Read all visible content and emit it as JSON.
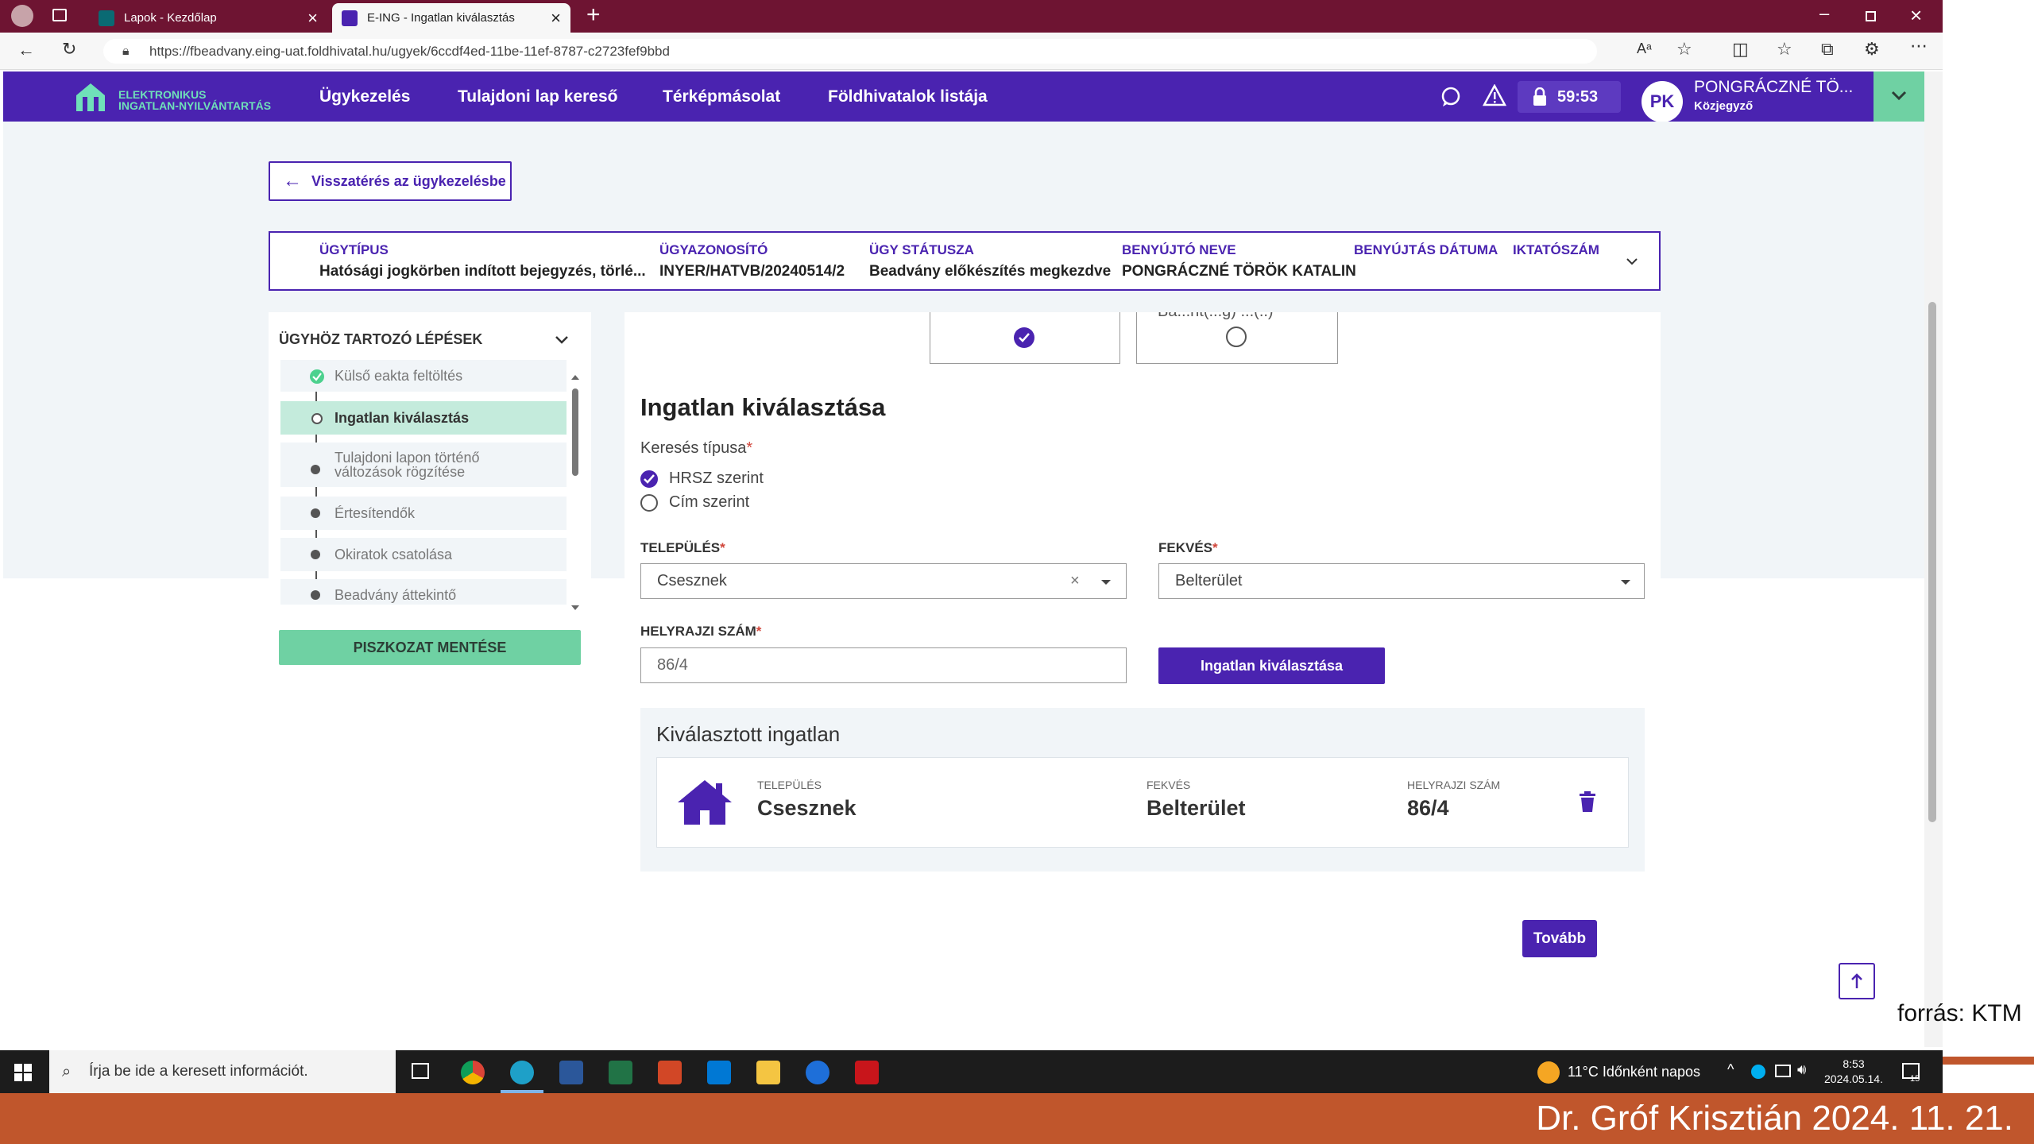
{
  "browser": {
    "tabs": [
      {
        "label": "Lapok - Kezdőlap"
      },
      {
        "label": "E-ING - Ingatlan kiválasztás"
      }
    ],
    "url": "https://fbeadvany.eing-uat.foldhivatal.hu/ugyek/6ccdf4ed-11be-11ef-8787-c2723fef9bbd"
  },
  "header": {
    "logo_line1": "ELEKTRONIKUS",
    "logo_line2": "INGATLAN-NYILVÁNTARTÁS",
    "nav": [
      "Ügykezelés",
      "Tulajdoni lap kereső",
      "Térképmásolat",
      "Földhivatalok listája"
    ],
    "timer": "59:53",
    "avatar": "PK",
    "user_name": "PONGRÁCZNÉ TÖ...",
    "user_role": "Közjegyző"
  },
  "back_button": "Visszatérés az ügykezelésbe",
  "case_info": {
    "columns": [
      {
        "label": "ÜGYTÍPUS",
        "value": "Hatósági jogkörben indított bejegyzés, törlé..."
      },
      {
        "label": "ÜGYAZONOSÍTÓ",
        "value": "INYER/HATVB/20240514/2"
      },
      {
        "label": "ÜGY STÁTUSZA",
        "value": "Beadvány előkészítés megkezdve"
      },
      {
        "label": "BENYÚJTÓ NEVE",
        "value": "PONGRÁCZNÉ TÖRÖK KATALIN"
      },
      {
        "label": "BENYÚJTÁS DÁTUMA",
        "value": ""
      },
      {
        "label": "IKTATÓSZÁM",
        "value": ""
      }
    ]
  },
  "steps": {
    "title": "ÜGYHÖZ TARTOZÓ LÉPÉSEK",
    "items": [
      {
        "label": "Külső eakta feltöltés",
        "state": "done"
      },
      {
        "label": "Ingatlan kiválasztás",
        "state": "active"
      },
      {
        "label": "Tulajdoni lapon történő változások rögzítése",
        "state": "todo"
      },
      {
        "label": "Értesítendők",
        "state": "todo"
      },
      {
        "label": "Okiratok csatolása",
        "state": "todo"
      },
      {
        "label": "Beadvány áttekintő",
        "state": "todo"
      }
    ],
    "save_draft": "PISZKOZAT MENTÉSE"
  },
  "form": {
    "choice_partial_label": "Ba...nt(...g) ...(..)",
    "title": "Ingatlan kiválasztása",
    "search_type_label": "Keresés típusa",
    "search_options": [
      {
        "label": "HRSZ szerint",
        "checked": true
      },
      {
        "label": "Cím szerint",
        "checked": false
      }
    ],
    "settlement_label": "TELEPÜLÉS",
    "settlement_value": "Csesznek",
    "location_label": "FEKVÉS",
    "location_value": "Belterület",
    "parcel_label": "HELYRAJZI SZÁM",
    "parcel_value": "86/4",
    "select_button": "Ingatlan kiválasztása",
    "selected": {
      "title": "Kiválasztott ingatlan",
      "settlement_label": "TELEPÜLÉS",
      "settlement": "Csesznek",
      "location_label": "FEKVÉS",
      "location": "Belterület",
      "parcel_label": "HELYRAJZI SZÁM",
      "parcel": "86/4"
    },
    "next_button": "Tovább"
  },
  "taskbar": {
    "search_placeholder": "Írja be ide a keresett információt.",
    "weather": "11°C  Időnként napos",
    "time": "8:53",
    "date": "2024.05.14.",
    "notification_count": "15"
  },
  "slide": {
    "source": "forrás: KTM",
    "footer": "Dr. Gróf Krisztián 2024. 11. 21."
  },
  "colors": {
    "brand_purple": "#4a23b0",
    "brand_green": "#6fd1a3",
    "tabbar": "#6e1432",
    "footer": "#c0562c"
  }
}
